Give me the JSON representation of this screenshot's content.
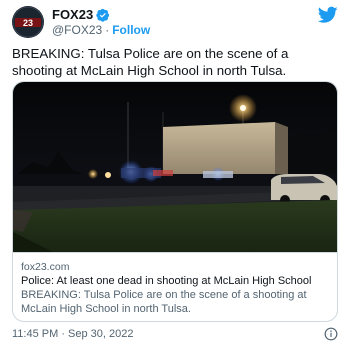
{
  "account": {
    "display_name": "FOX23",
    "handle": "@FOX23",
    "separator": "·",
    "follow_label": "Follow",
    "avatar_text": "23"
  },
  "tweet": {
    "text": "BREAKING: Tulsa Police are on the scene of a shooting at McLain High School in north Tulsa."
  },
  "card": {
    "domain": "fox23.com",
    "title": "Police: At least one dead in shooting at McLain High School",
    "description": "BREAKING: Tulsa Police are on the scene of a shooting at McLain High School in north Tulsa."
  },
  "footer": {
    "timestamp": "11:45 PM · Sep 30, 2022"
  },
  "colors": {
    "accent": "#1d9bf0",
    "text_primary": "#0f1419",
    "text_secondary": "#536471",
    "border": "#cfd9de"
  },
  "icons": {
    "verified": "verified-badge-icon",
    "brand": "twitter-bird-icon",
    "info": "info-icon"
  }
}
